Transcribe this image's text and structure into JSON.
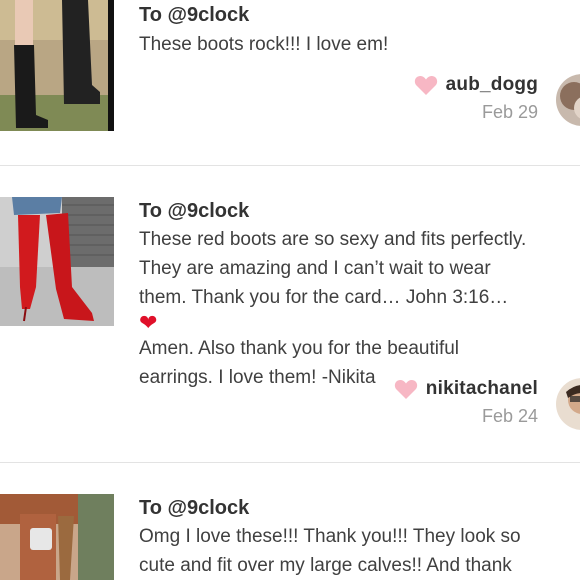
{
  "reviews": [
    {
      "to_line": "To @9clock",
      "lines": [
        "These boots rock!!! I love em!"
      ],
      "username": "aub_dogg",
      "date": "Feb 29"
    },
    {
      "to_line": "To @9clock",
      "lines": [
        "These red boots are so sexy and fits perfectly.",
        "They are amazing and I can’t wait to wear",
        "them. Thank you for the card… John 3:16…",
        "Amen. Also thank you for the beautiful",
        "earrings. I love them! -Nikita"
      ],
      "username": "nikitachanel",
      "date": "Feb 24"
    },
    {
      "to_line": "To @9clock",
      "lines": [
        "Omg I love these!!! Thank you!!! They look so",
        "cute and fit over my large calves!! And thank"
      ]
    }
  ],
  "colors": {
    "like_heart": "#f7b7c4",
    "emoji_heart": "#e0102a",
    "username": "#333333",
    "date": "#9a9a9a"
  },
  "icons": {
    "like": "heart-icon",
    "emoji": "red-heart-emoji"
  }
}
